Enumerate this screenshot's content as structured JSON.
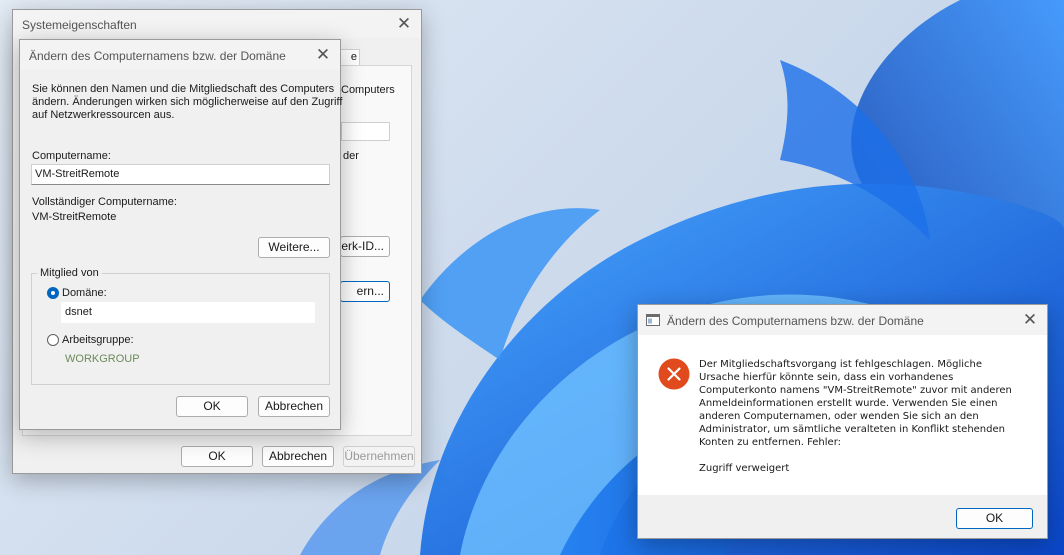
{
  "sysprops": {
    "title": "Systemeigenschaften",
    "tab_fragment": "e",
    "frag_computers": "Computers",
    "frag_oder": "der",
    "frag_netzwerk_btn": "erk-ID...",
    "frag_aendern_btn": "ern...",
    "ok": "OK",
    "cancel": "Abbrechen",
    "apply": "Übernehmen"
  },
  "rename": {
    "title": "Ändern des Computernamens bzw. der Domäne",
    "description": [
      "Sie können den Namen und die Mitgliedschaft des Computers",
      "ändern. Änderungen wirken sich möglicherweise auf den Zugriff",
      "auf Netzwerkressourcen aus."
    ],
    "computername_label": "Computername:",
    "computername_value": "VM-StreitRemote",
    "fullname_label": "Vollständiger Computername:",
    "fullname_value": "VM-StreitRemote",
    "more_button": "Weitere...",
    "member_of": "Mitglied von",
    "domain_label": "Domäne:",
    "domain_value": "dsnet",
    "workgroup_label": "Arbeitsgruppe:",
    "workgroup_value": "WORKGROUP",
    "ok": "OK",
    "cancel": "Abbrechen"
  },
  "error": {
    "title": "Ändern des Computernamens bzw. der Domäne",
    "message": [
      "Der Mitgliedschaftsvorgang ist fehlgeschlagen. Mögliche",
      "Ursache hierfür könnte sein, dass ein vorhandenes",
      "Computerkonto namens \"VM-StreitRemote\" zuvor mit anderen",
      "Anmeldeinformationen erstellt wurde. Verwenden Sie einen",
      "anderen Computernamen, oder wenden Sie sich an den",
      "Administrator, um sämtliche veralteten in Konflikt stehenden",
      "Konten zu entfernen. Fehler:"
    ],
    "detail": "Zugriff verweigert",
    "ok": "OK"
  },
  "colors": {
    "accent": "#0067c0",
    "error_icon": "#e04a1c",
    "workgroup_text": "#6d8a5a"
  },
  "icons": {
    "error": "error-x-icon",
    "window": "window-icon",
    "close": "close-icon"
  }
}
